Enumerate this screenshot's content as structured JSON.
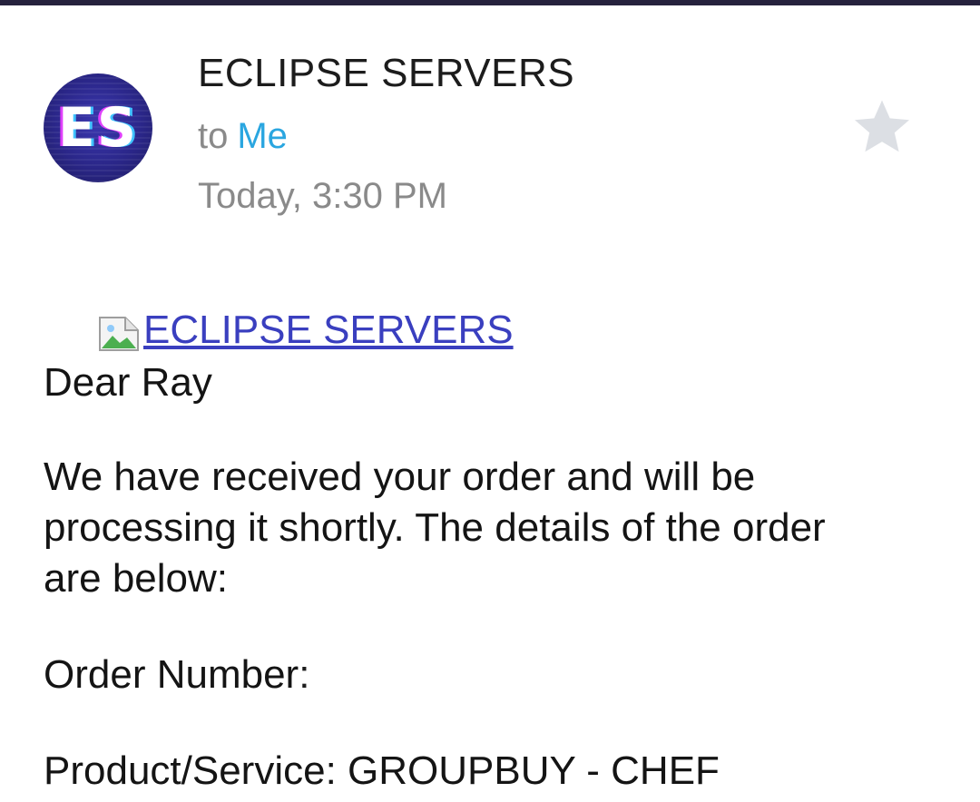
{
  "header": {
    "avatar_initials": "ES",
    "sender": "ECLIPSE SERVERS",
    "to_label": "to",
    "recipient": "Me",
    "timestamp": "Today, 3:30 PM",
    "star_icon": "star-icon"
  },
  "message": {
    "banner_link": "ECLIPSE SERVERS",
    "greeting": "Dear Ray",
    "paragraph_lines": [
      "We have received your order and will be",
      "processing it shortly. The details of the order",
      "are below:"
    ],
    "order_number_label": "Order Number:",
    "product_line": "Product/Service: GROUPBUY - CHEF"
  },
  "colors": {
    "top_bar": "#26223d",
    "avatar": "#2a2688",
    "recipient": "#2aa6e0",
    "link": "#3a3fbf",
    "muted": "#8a8a8a"
  }
}
